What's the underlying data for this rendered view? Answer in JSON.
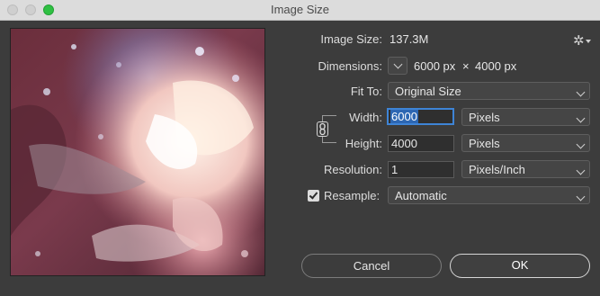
{
  "window": {
    "title": "Image Size"
  },
  "image_size": {
    "label": "Image Size:",
    "value": "137.3M"
  },
  "dimensions": {
    "label": "Dimensions:",
    "width": "6000 px",
    "times": "×",
    "height": "4000 px"
  },
  "fit_to": {
    "label": "Fit To:",
    "value": "Original Size"
  },
  "width": {
    "label": "Width:",
    "value": "6000",
    "unit": "Pixels"
  },
  "height": {
    "label": "Height:",
    "value": "4000",
    "unit": "Pixels"
  },
  "resolution": {
    "label": "Resolution:",
    "value": "1",
    "unit": "Pixels/Inch"
  },
  "resample": {
    "label": "Resample:",
    "checked": true,
    "value": "Automatic"
  },
  "buttons": {
    "cancel": "Cancel",
    "ok": "OK"
  },
  "icons": {
    "settings": "gear-icon",
    "link": "chain-link-icon"
  },
  "colors": {
    "traffic_green": "#2fc043",
    "focus_blue": "#3e84d6",
    "dialog_bg": "#3c3c3c"
  }
}
